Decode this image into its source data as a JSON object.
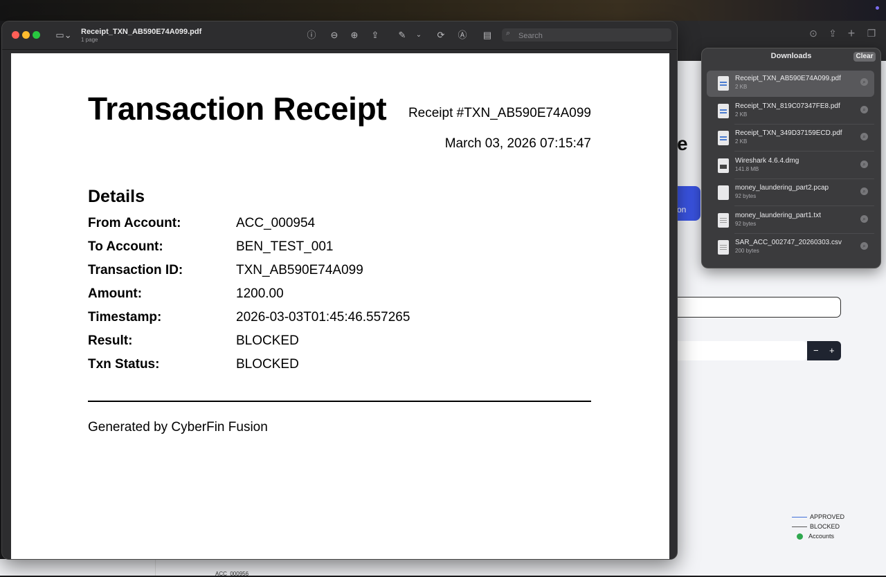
{
  "preview_window": {
    "title": "Receipt_TXN_AB590E74A099.pdf",
    "subtitle": "1 page",
    "search_placeholder": "Search"
  },
  "receipt": {
    "title": "Transaction Receipt",
    "receipt_number": "Receipt #TXN_AB590E74A099",
    "date": "March 03, 2026 07:15:47",
    "details_heading": "Details",
    "fields": [
      {
        "label": "From Account:",
        "value": "ACC_000954"
      },
      {
        "label": "To Account:",
        "value": "BEN_TEST_001"
      },
      {
        "label": "Transaction ID:",
        "value": "TXN_AB590E74A099"
      },
      {
        "label": "Amount:",
        "value": "1200.00"
      },
      {
        "label": "Timestamp:",
        "value": "2026-03-03T01:45:46.557265"
      },
      {
        "label": "Result:",
        "value": "BLOCKED"
      },
      {
        "label": "Txn Status:",
        "value": "BLOCKED"
      }
    ],
    "footer": "Generated by CyberFin Fusion"
  },
  "downloads": {
    "title": "Downloads",
    "clear_label": "Clear",
    "items": [
      {
        "name": "Receipt_TXN_AB590E74A099.pdf",
        "size": "2 KB",
        "kind": "pdf"
      },
      {
        "name": "Receipt_TXN_819C07347FE8.pdf",
        "size": "2 KB",
        "kind": "pdf"
      },
      {
        "name": "Receipt_TXN_349D37159ECD.pdf",
        "size": "2 KB",
        "kind": "pdf"
      },
      {
        "name": "Wireshark 4.6.4.dmg",
        "size": "141.8 MB",
        "kind": "dmg"
      },
      {
        "name": "money_laundering_part2.pcap",
        "size": "92 bytes",
        "kind": "doc"
      },
      {
        "name": "money_laundering_part1.txt",
        "size": "92 bytes",
        "kind": "doc"
      },
      {
        "name": "SAR_ACC_002747_20260303.csv",
        "size": "200 bytes",
        "kind": "doc"
      }
    ]
  },
  "background_page": {
    "heading_fragment": "e",
    "button_fragment": "on",
    "stepper_minus": "−",
    "stepper_plus": "+",
    "legend": [
      {
        "label": "APPROVED",
        "color": "#3f6fd8"
      },
      {
        "label": "BLOCKED",
        "color": "#555555"
      },
      {
        "label": "Accounts",
        "color": "#2fa84f"
      }
    ],
    "bottom_label": "ACC_000956"
  },
  "colors": {
    "traffic_close": "#ff5f57",
    "traffic_minimize": "#febc2e",
    "traffic_zoom": "#28c840",
    "accent_blue": "#3b55e6"
  }
}
